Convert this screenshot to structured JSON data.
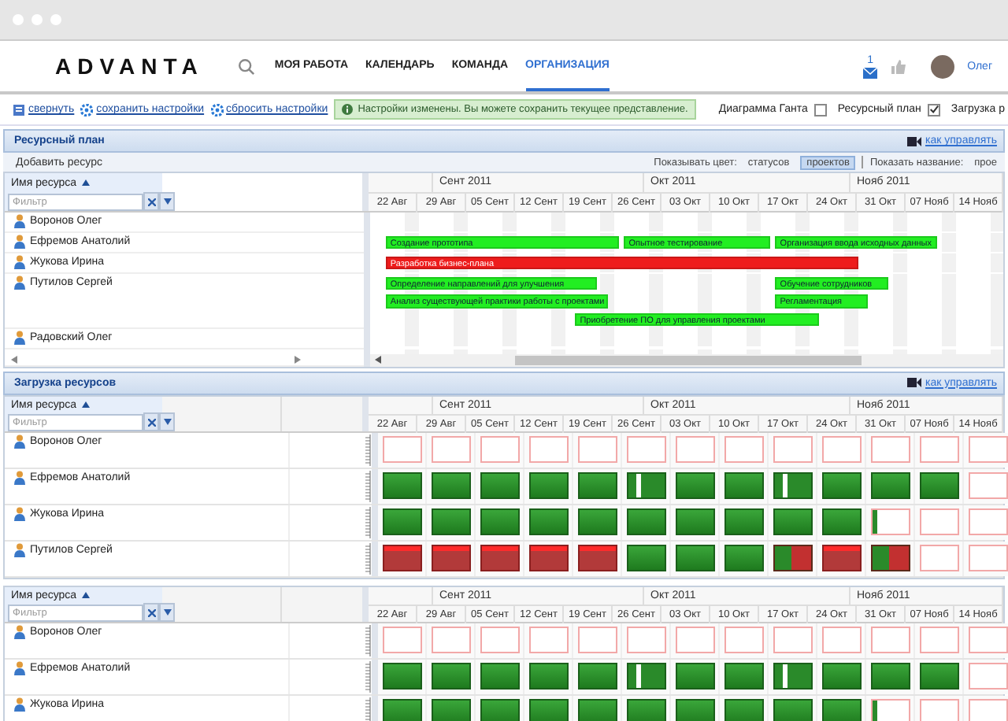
{
  "header": {
    "logo": "ADVANTA",
    "nav": [
      {
        "label": "МОЯ РАБОТА",
        "selected": false
      },
      {
        "label": "КАЛЕНДАРЬ",
        "selected": false
      },
      {
        "label": "КОМАНДА",
        "selected": false
      },
      {
        "label": "ОРГАНИЗАЦИЯ",
        "selected": true
      }
    ],
    "mail_count": "1",
    "user": "Олег"
  },
  "toolbar": {
    "links": [
      "свернуть",
      "сохранить настройки",
      "сбросить настройки"
    ],
    "notice": "Настройки изменены. Вы можете сохранить текущее представление.",
    "toggles": [
      {
        "label": "Диаграмма Ганта",
        "checked": false
      },
      {
        "label": "Ресурсный план",
        "checked": true
      },
      {
        "label": "Загрузка р"
      }
    ]
  },
  "resource_plan": {
    "title": "Ресурсный план",
    "help_link": "как управлять",
    "add_button": "Добавить ресурс",
    "color_label": "Показывать цвет:",
    "color_options": [
      {
        "label": "статусов",
        "selected": false
      },
      {
        "label": "проектов",
        "selected": true
      }
    ],
    "name_label": "Показать название:",
    "name_options": [
      {
        "label": "прое",
        "selected": false
      }
    ],
    "column_header": "Имя ресурса",
    "filter": {
      "placeholder": "Фильтр"
    },
    "months": [
      "Сент 2011",
      "Окт 2011",
      "Нояб 2011"
    ],
    "weeks": [
      "22 Авг",
      "29 Авг",
      "05 Сент",
      "12 Сент",
      "19 Сент",
      "26 Сент",
      "03 Окт",
      "10 Окт",
      "17 Окт",
      "24 Окт",
      "31 Окт",
      "07 Нояб",
      "14 Нояб"
    ],
    "resources": [
      {
        "name": "Воронов Олег"
      },
      {
        "name": "Ефремов Анатолий",
        "lanes": [
          [
            {
              "label": "Создание прототипа",
              "color": "#22ee22"
            },
            {
              "label": "Опытное тестирование",
              "color": "#22ee22"
            },
            {
              "label": "Организация ввода исходных данных",
              "color": "#22ee22"
            }
          ]
        ]
      },
      {
        "name": "Жукова Ирина",
        "lanes": [
          [
            {
              "label": "Разработка бизнес-плана",
              "color": "#ee1c1c"
            }
          ]
        ]
      },
      {
        "name": "Путилов Сергей",
        "lanes": [
          [
            {
              "label": "Определение направлений для улучшения",
              "color": "#22ee22"
            },
            {
              "label": "Обучение сотрудников",
              "color": "#22ee22"
            }
          ],
          [
            {
              "label": "Анализ существующей практики работы с проектами",
              "color": "#22ee22"
            },
            {
              "label": "Регламентация",
              "color": "#22ee22"
            }
          ],
          [
            {
              "label": "Приобретение ПО для управления проектами",
              "color": "#22ee22"
            }
          ]
        ]
      },
      {
        "name": "Радовский Олег"
      }
    ]
  },
  "resource_load": {
    "title": "Загрузка ресурсов",
    "help_link": "как управлять",
    "grids": [
      {
        "column_header": "Имя ресурса",
        "filter": {
          "placeholder": "Фильтр"
        },
        "months": [
          "Сент 2011",
          "Окт 2011",
          "Нояб 2011"
        ],
        "weeks": [
          "22 Авг",
          "29 Авг",
          "05 Сент",
          "12 Сент",
          "19 Сент",
          "26 Сент",
          "03 Окт",
          "10 Окт",
          "17 Окт",
          "24 Окт",
          "31 Окт",
          "07 Нояб",
          "14 Нояб"
        ],
        "rows": [
          {
            "name": "Воронов Олег",
            "cells": [
              {
                "kind": "empty"
              },
              {
                "kind": "empty"
              },
              {
                "kind": "empty"
              },
              {
                "kind": "empty"
              },
              {
                "kind": "empty"
              },
              {
                "kind": "empty"
              },
              {
                "kind": "empty"
              },
              {
                "kind": "empty"
              },
              {
                "kind": "empty"
              },
              {
                "kind": "empty"
              },
              {
                "kind": "empty"
              },
              {
                "kind": "empty"
              },
              {
                "kind": "empty"
              }
            ]
          },
          {
            "name": "Ефремов Анатолий",
            "cells": [
              {
                "kind": "ok"
              },
              {
                "kind": "ok"
              },
              {
                "kind": "ok"
              },
              {
                "kind": "ok"
              },
              {
                "kind": "ok"
              },
              {
                "kind": "split"
              },
              {
                "kind": "ok"
              },
              {
                "kind": "ok"
              },
              {
                "kind": "split"
              },
              {
                "kind": "ok"
              },
              {
                "kind": "ok"
              },
              {
                "kind": "ok"
              },
              {
                "kind": "empty"
              }
            ]
          },
          {
            "name": "Жукова Ирина",
            "cells": [
              {
                "kind": "ok"
              },
              {
                "kind": "ok"
              },
              {
                "kind": "ok"
              },
              {
                "kind": "ok"
              },
              {
                "kind": "ok"
              },
              {
                "kind": "ok"
              },
              {
                "kind": "ok"
              },
              {
                "kind": "ok"
              },
              {
                "kind": "ok"
              },
              {
                "kind": "ok"
              },
              {
                "kind": "low"
              },
              {
                "kind": "empty"
              },
              {
                "kind": "empty"
              }
            ]
          },
          {
            "name": "Путилов Сергей",
            "cells": [
              {
                "kind": "over"
              },
              {
                "kind": "over"
              },
              {
                "kind": "over"
              },
              {
                "kind": "over"
              },
              {
                "kind": "over"
              },
              {
                "kind": "ok"
              },
              {
                "kind": "ok"
              },
              {
                "kind": "ok"
              },
              {
                "kind": "mixed"
              },
              {
                "kind": "over"
              },
              {
                "kind": "mixed"
              },
              {
                "kind": "empty"
              },
              {
                "kind": "empty"
              }
            ]
          }
        ]
      },
      {
        "column_header": "Имя ресурса",
        "filter": {
          "placeholder": "Фильтр"
        },
        "months": [
          "Сент 2011",
          "Окт 2011",
          "Нояб 2011"
        ],
        "weeks": [
          "22 Авг",
          "29 Авг",
          "05 Сент",
          "12 Сент",
          "19 Сент",
          "26 Сент",
          "03 Окт",
          "10 Окт",
          "17 Окт",
          "24 Окт",
          "31 Окт",
          "07 Нояб",
          "14 Нояб"
        ],
        "rows": [
          {
            "name": "Воронов Олег",
            "cells": [
              {
                "kind": "empty"
              },
              {
                "kind": "empty"
              },
              {
                "kind": "empty"
              },
              {
                "kind": "empty"
              },
              {
                "kind": "empty"
              },
              {
                "kind": "empty"
              },
              {
                "kind": "empty"
              },
              {
                "kind": "empty"
              },
              {
                "kind": "empty"
              },
              {
                "kind": "empty"
              },
              {
                "kind": "empty"
              },
              {
                "kind": "empty"
              },
              {
                "kind": "empty"
              }
            ]
          },
          {
            "name": "Ефремов Анатолий",
            "cells": [
              {
                "kind": "ok"
              },
              {
                "kind": "ok"
              },
              {
                "kind": "ok"
              },
              {
                "kind": "ok"
              },
              {
                "kind": "ok"
              },
              {
                "kind": "split"
              },
              {
                "kind": "ok"
              },
              {
                "kind": "ok"
              },
              {
                "kind": "split"
              },
              {
                "kind": "ok"
              },
              {
                "kind": "ok"
              },
              {
                "kind": "ok"
              },
              {
                "kind": "empty"
              }
            ]
          },
          {
            "name": "Жукова Ирина",
            "cells": [
              {
                "kind": "ok"
              },
              {
                "kind": "ok"
              },
              {
                "kind": "ok"
              },
              {
                "kind": "ok"
              },
              {
                "kind": "ok"
              },
              {
                "kind": "ok"
              },
              {
                "kind": "ok"
              },
              {
                "kind": "ok"
              },
              {
                "kind": "ok"
              },
              {
                "kind": "ok"
              },
              {
                "kind": "low"
              },
              {
                "kind": "empty"
              },
              {
                "kind": "empty"
              }
            ]
          }
        ]
      }
    ]
  }
}
